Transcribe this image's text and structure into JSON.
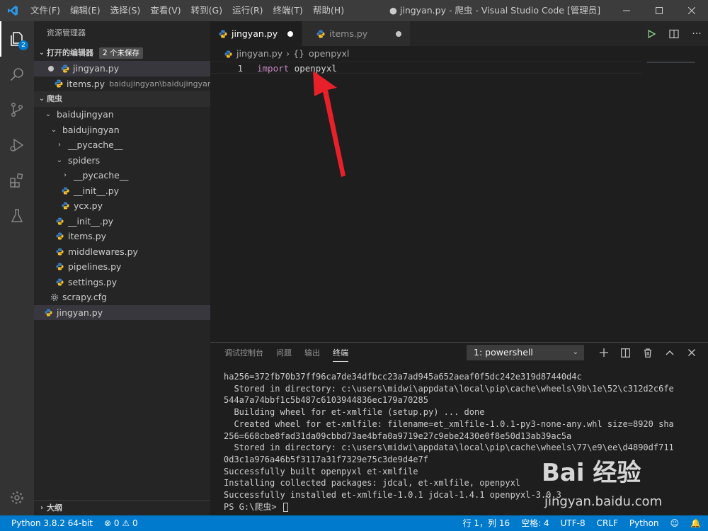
{
  "titlebar": {
    "menus": [
      "文件(F)",
      "编辑(E)",
      "选择(S)",
      "查看(V)",
      "转到(G)",
      "运行(R)",
      "终端(T)",
      "帮助(H)"
    ],
    "title": "● jingyan.py - 爬虫 - Visual Studio Code [管理员]"
  },
  "activitybar": {
    "explorer_badge": "2"
  },
  "sidebar": {
    "title": "资源管理器",
    "open_editors": {
      "label": "打开的编辑器",
      "badge": "2 个未保存",
      "items": [
        {
          "name": "jingyan.py",
          "desc": ""
        },
        {
          "name": "items.py",
          "desc": "baidujingyan\\baidujingyan"
        }
      ]
    },
    "workspace": {
      "label": "爬虫",
      "tree": [
        {
          "name": "baidujingyan"
        },
        {
          "name": "baidujingyan"
        },
        {
          "name": "__pycache__"
        },
        {
          "name": "spiders"
        },
        {
          "name": "__pycache__"
        },
        {
          "name": "__init__.py"
        },
        {
          "name": "ycx.py"
        },
        {
          "name": "__init__.py"
        },
        {
          "name": "items.py"
        },
        {
          "name": "middlewares.py"
        },
        {
          "name": "pipelines.py"
        },
        {
          "name": "settings.py"
        },
        {
          "name": "scrapy.cfg"
        },
        {
          "name": "jingyan.py"
        }
      ]
    },
    "outline_label": "大纲"
  },
  "editor": {
    "tabs": [
      {
        "label": "jingyan.py"
      },
      {
        "label": "items.py"
      }
    ],
    "breadcrumb": {
      "file": "jingyan.py",
      "symbol_icon": "{}",
      "symbol": "openpyxl"
    },
    "lines": [
      {
        "number": "1",
        "keyword": "import",
        "rest": " openpyxl"
      }
    ]
  },
  "panel": {
    "tabs": [
      "调试控制台",
      "问题",
      "输出",
      "终端"
    ],
    "terminal_select": "1: powershell",
    "terminal_lines": [
      "ha256=372fb70b37ff96ca7de34dfbcc23a7ad945a652aeaf0f5dc242e319d87440d4c",
      "  Stored in directory: c:\\users\\midwi\\appdata\\local\\pip\\cache\\wheels\\9b\\1e\\52\\c312d2c6fe",
      "544a7a74bbf1c5b487c6103944836ec179a70285",
      "  Building wheel for et-xmlfile (setup.py) ... done",
      "  Created wheel for et-xmlfile: filename=et_xmlfile-1.0.1-py3-none-any.whl size=8920 sha",
      "256=668cbe8fad31da09cbbd73ae4bfa0a9719e27c9ebe2430e0f8e50d13ab39ac5a",
      "  Stored in directory: c:\\users\\midwi\\appdata\\local\\pip\\cache\\wheels\\77\\e9\\ee\\d4890df711",
      "0d3c1a976a46b5f3117a31f7329e75c3de9d4e7f",
      "Successfully built openpyxl et-xmlfile",
      "Installing collected packages: jdcal, et-xmlfile, openpyxl",
      "Successfully installed et-xmlfile-1.0.1 jdcal-1.4.1 openpyxl-3.0.3"
    ],
    "prompt": "PS G:\\爬虫> "
  },
  "statusbar": {
    "python": "Python 3.8.2 64-bit",
    "errors": "0",
    "warnings": "0",
    "position": "行 1，列 16",
    "spaces": "空格: 4",
    "encoding": "UTF-8",
    "eol": "CRLF",
    "language": "Python"
  },
  "watermark": {
    "logo": "Bai 经验",
    "url": "jingyan.baidu.com"
  },
  "colors": {
    "accent": "#007acc",
    "arrow": "#e8202a",
    "keyword": "#c586c0",
    "python_icon": "#3572a5"
  }
}
